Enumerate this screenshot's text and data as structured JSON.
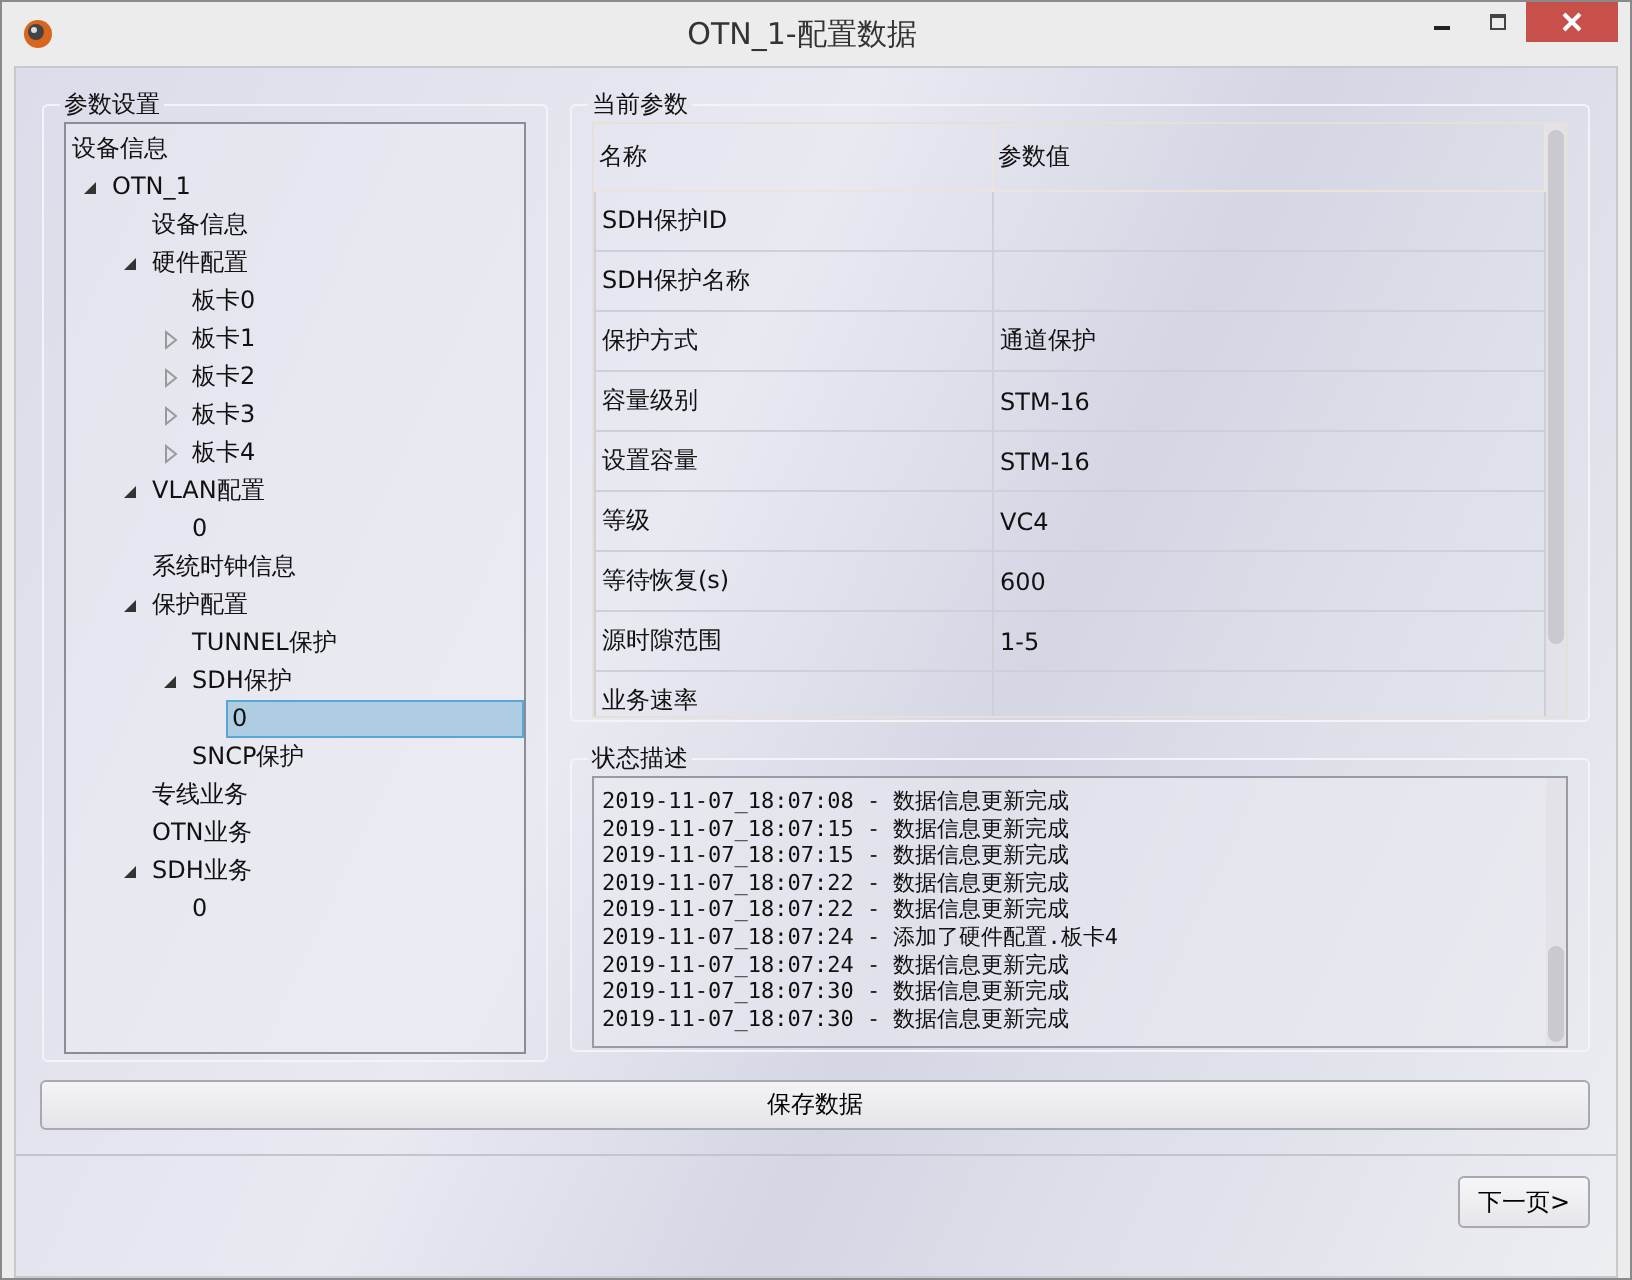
{
  "window": {
    "title": "OTN_1-配置数据"
  },
  "params_group": {
    "title": "参数设置",
    "header": "设备信息",
    "tree": [
      {
        "label": "OTN_1",
        "kind": "branch",
        "expanded": true,
        "selected": false,
        "children": [
          {
            "label": "设备信息",
            "kind": "leaf",
            "selected": false
          },
          {
            "label": "硬件配置",
            "kind": "branch",
            "expanded": true,
            "selected": false,
            "children": [
              {
                "label": "板卡0",
                "kind": "leaf",
                "selected": false
              },
              {
                "label": "板卡1",
                "kind": "branch",
                "expanded": false,
                "selected": false
              },
              {
                "label": "板卡2",
                "kind": "branch",
                "expanded": false,
                "selected": false
              },
              {
                "label": "板卡3",
                "kind": "branch",
                "expanded": false,
                "selected": false
              },
              {
                "label": "板卡4",
                "kind": "branch",
                "expanded": false,
                "selected": false
              }
            ]
          },
          {
            "label": "VLAN配置",
            "kind": "branch",
            "expanded": true,
            "selected": false,
            "children": [
              {
                "label": "0",
                "kind": "leaf",
                "selected": false
              }
            ]
          },
          {
            "label": "系统时钟信息",
            "kind": "leaf",
            "selected": false
          },
          {
            "label": "保护配置",
            "kind": "branch",
            "expanded": true,
            "selected": false,
            "children": [
              {
                "label": "TUNNEL保护",
                "kind": "leaf",
                "selected": false
              },
              {
                "label": "SDH保护",
                "kind": "branch",
                "expanded": true,
                "selected": false,
                "children": [
                  {
                    "label": "0",
                    "kind": "leaf",
                    "selected": true
                  }
                ]
              },
              {
                "label": "SNCP保护",
                "kind": "leaf",
                "selected": false
              }
            ]
          },
          {
            "label": "专线业务",
            "kind": "leaf",
            "selected": false
          },
          {
            "label": "OTN业务",
            "kind": "leaf",
            "selected": false
          },
          {
            "label": "SDH业务",
            "kind": "branch",
            "expanded": true,
            "selected": false,
            "children": [
              {
                "label": "0",
                "kind": "leaf",
                "selected": false
              }
            ]
          }
        ]
      }
    ]
  },
  "current_params": {
    "title": "当前参数",
    "columns": [
      "名称",
      "参数值"
    ],
    "rows": [
      {
        "name": "SDH保护ID",
        "value": ""
      },
      {
        "name": "SDH保护名称",
        "value": ""
      },
      {
        "name": "保护方式",
        "value": "通道保护"
      },
      {
        "name": "容量级别",
        "value": "STM-16"
      },
      {
        "name": "设置容量",
        "value": "STM-16"
      },
      {
        "name": "等级",
        "value": "VC4"
      },
      {
        "name": "等待恢复(s)",
        "value": "600"
      },
      {
        "name": "源时隙范围",
        "value": "1-5"
      },
      {
        "name": "业务速率",
        "value": ""
      }
    ]
  },
  "status": {
    "title": "状态描述",
    "log": [
      "2019-11-07_18:07:08 - 数据信息更新完成",
      "2019-11-07_18:07:15 - 数据信息更新完成",
      "2019-11-07_18:07:15 - 数据信息更新完成",
      "2019-11-07_18:07:22 - 数据信息更新完成",
      "2019-11-07_18:07:22 - 数据信息更新完成",
      "2019-11-07_18:07:24 - 添加了硬件配置.板卡4",
      "2019-11-07_18:07:24 - 数据信息更新完成",
      "2019-11-07_18:07:30 - 数据信息更新完成",
      "2019-11-07_18:07:30 - 数据信息更新完成"
    ]
  },
  "save_button": "保存数据",
  "next_button": "下一页>"
}
